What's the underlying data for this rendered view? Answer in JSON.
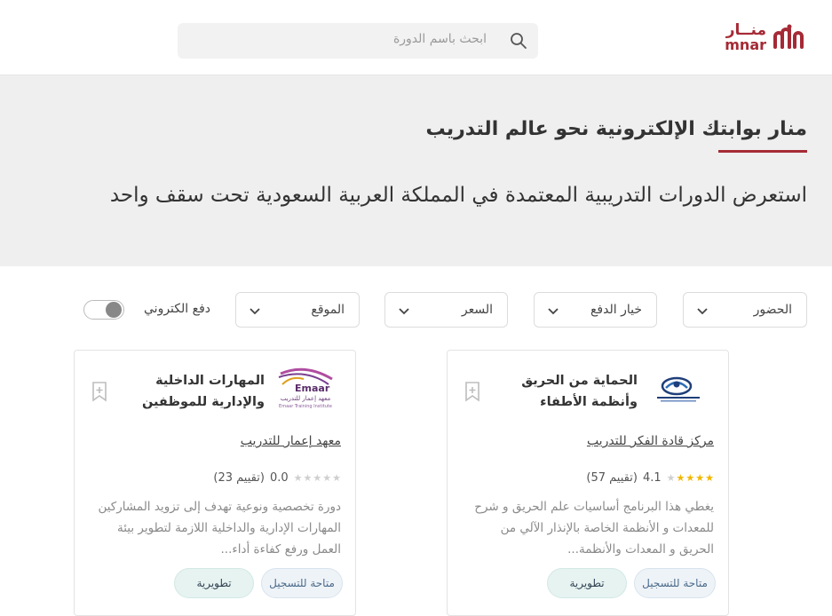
{
  "header": {
    "logo_ar": "منــار",
    "logo_en": "mnar",
    "search_placeholder": "ابحث باسم الدورة"
  },
  "hero": {
    "title": "منار بوابتك الإلكترونية نحو عالم التدريب",
    "subtitle": "استعرض الدورات التدريبية المعتمدة في المملكة العربية السعودية تحت سقف واحد"
  },
  "filters": {
    "attendance": "الحضور",
    "payment_option": "خيار الدفع",
    "price": "السعر",
    "location": "الموقع",
    "e_payment": "دفع الكتروني"
  },
  "cards": [
    {
      "title": "الحماية من الحريق وأنظمة الأطفاء",
      "provider": "مركز قادة الفكر للتدريب",
      "rating_value": "4.1",
      "rating_count": "(57 تقييم)",
      "stars_filled": 4,
      "description": "يغطي هذا البرنامج أساسيات علم الحريق و شرح للمعدات و الأنظمة الخاصة بالإنذار الآلي من الحريق و المعدات والأنظمة...",
      "status_tag": "متاحة للتسجيل",
      "type_tag": "تطويرية"
    },
    {
      "title": "المهارات الداخلية والإدارية للموظفين",
      "provider": "معهد إعمار للتدريب",
      "rating_value": "0.0",
      "rating_count": "(23 تقييم)",
      "stars_filled": 0,
      "description": "دورة تخصصية ونوعية تهدف إلى تزويد المشاركين المهارات الإدارية والداخلية اللازمة لتطوير بيئة العمل ورفع كفاءة أداء...",
      "status_tag": "متاحة للتسجيل",
      "type_tag": "تطويرية",
      "logo_text": "Emaar Training Institute",
      "logo_text_ar": "معهد إعمار للتدريب"
    }
  ],
  "colors": {
    "brand": "#a52a35",
    "star_filled": "#f2b600",
    "star_empty": "#cfcfcf"
  }
}
